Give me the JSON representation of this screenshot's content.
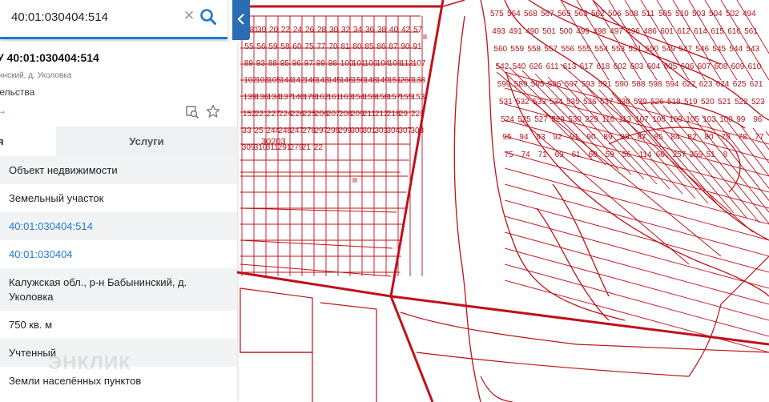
{
  "search": {
    "value": "40:01:030404:514"
  },
  "object": {
    "title": "У 40:01:030404:514",
    "address": "инский, д. Уколовка",
    "purpose": "тельства",
    "share": "→"
  },
  "tabs": {
    "info": "я",
    "services": "Услуги"
  },
  "rows": [
    "Объект недвижимости",
    "Земельный участок",
    "40:01:030404:514",
    "40:01:030404",
    "Калужская обл., р-н Бабынинский, д. Уколовка",
    "750 кв. м",
    "Учтенный",
    "Земли населённых пунктов"
  ],
  "watermark": "ЭНКЛИК",
  "map": {
    "quarter_label": "30203",
    "parcels_left": [
      "181",
      "30",
      "20",
      "22",
      "24",
      "26",
      "28",
      "30",
      "32",
      "34",
      "36",
      "38",
      "40",
      "42",
      "57",
      "55",
      "56",
      "59",
      "58",
      "60",
      "75",
      "77",
      "70",
      "81",
      "80",
      "85",
      "86",
      "87",
      "90",
      "91",
      "89",
      "93",
      "88",
      "95",
      "96",
      "97",
      "99",
      "98",
      "100",
      "101",
      "106",
      "104",
      "108",
      "112",
      "107",
      "102",
      "103",
      "105",
      "144",
      "142",
      "140",
      "143",
      "145",
      "146",
      "150",
      "148",
      "149",
      "151",
      "260",
      "138",
      "139",
      "136",
      "134",
      "137",
      "140",
      "178",
      "162",
      "161",
      "163",
      "154",
      "159",
      "158",
      "157",
      "155",
      "153",
      "152",
      "221",
      "227",
      "224",
      "226",
      "225",
      "206",
      "207",
      "208",
      "209",
      "211",
      "212",
      "218",
      "29",
      "228",
      "33",
      "25",
      "244",
      "248",
      "247",
      "278",
      "297",
      "298",
      "299",
      "300",
      "301",
      "303",
      "304",
      "307",
      "308",
      "309",
      "310",
      "311",
      "291",
      "279",
      "21",
      "22"
    ],
    "parcels_right": [
      "575",
      "564",
      "568",
      "567",
      "565",
      "563",
      "562",
      "506",
      "508",
      "511",
      "505",
      "510",
      "503",
      "504",
      "502",
      "494",
      "493",
      "491",
      "490",
      "501",
      "500",
      "499",
      "498",
      "497",
      "496",
      "486",
      "601",
      "612",
      "614",
      "615",
      "616",
      "561",
      "560",
      "559",
      "558",
      "557",
      "556",
      "555",
      "554",
      "553",
      "551",
      "550",
      "549",
      "547",
      "546",
      "545",
      "544",
      "543",
      "542",
      "540",
      "626",
      "611",
      "613",
      "617",
      "618",
      "602",
      "603",
      "604",
      "605",
      "606",
      "607",
      "608",
      "609",
      "610",
      "599",
      "589",
      "595",
      "596",
      "597",
      "593",
      "591",
      "590",
      "588",
      "598",
      "594",
      "622",
      "623",
      "624",
      "625",
      "621",
      "531",
      "532",
      "533",
      "534",
      "535",
      "536",
      "537",
      "538",
      "539",
      "526",
      "518",
      "519",
      "520",
      "521",
      "522",
      "523",
      "524",
      "525",
      "527",
      "529",
      "530",
      "229",
      "116",
      "113",
      "107",
      "108",
      "109",
      "105",
      "103",
      "100",
      "99",
      "96",
      "95",
      "94",
      "93",
      "92",
      "91",
      "90",
      "89",
      "88",
      "87",
      "85",
      "84",
      "82",
      "80",
      "79",
      "78",
      "77",
      "75",
      "74",
      "71",
      "69",
      "61",
      "60",
      "59",
      "56",
      "114",
      "66",
      "257",
      "259",
      "51",
      "8"
    ]
  }
}
